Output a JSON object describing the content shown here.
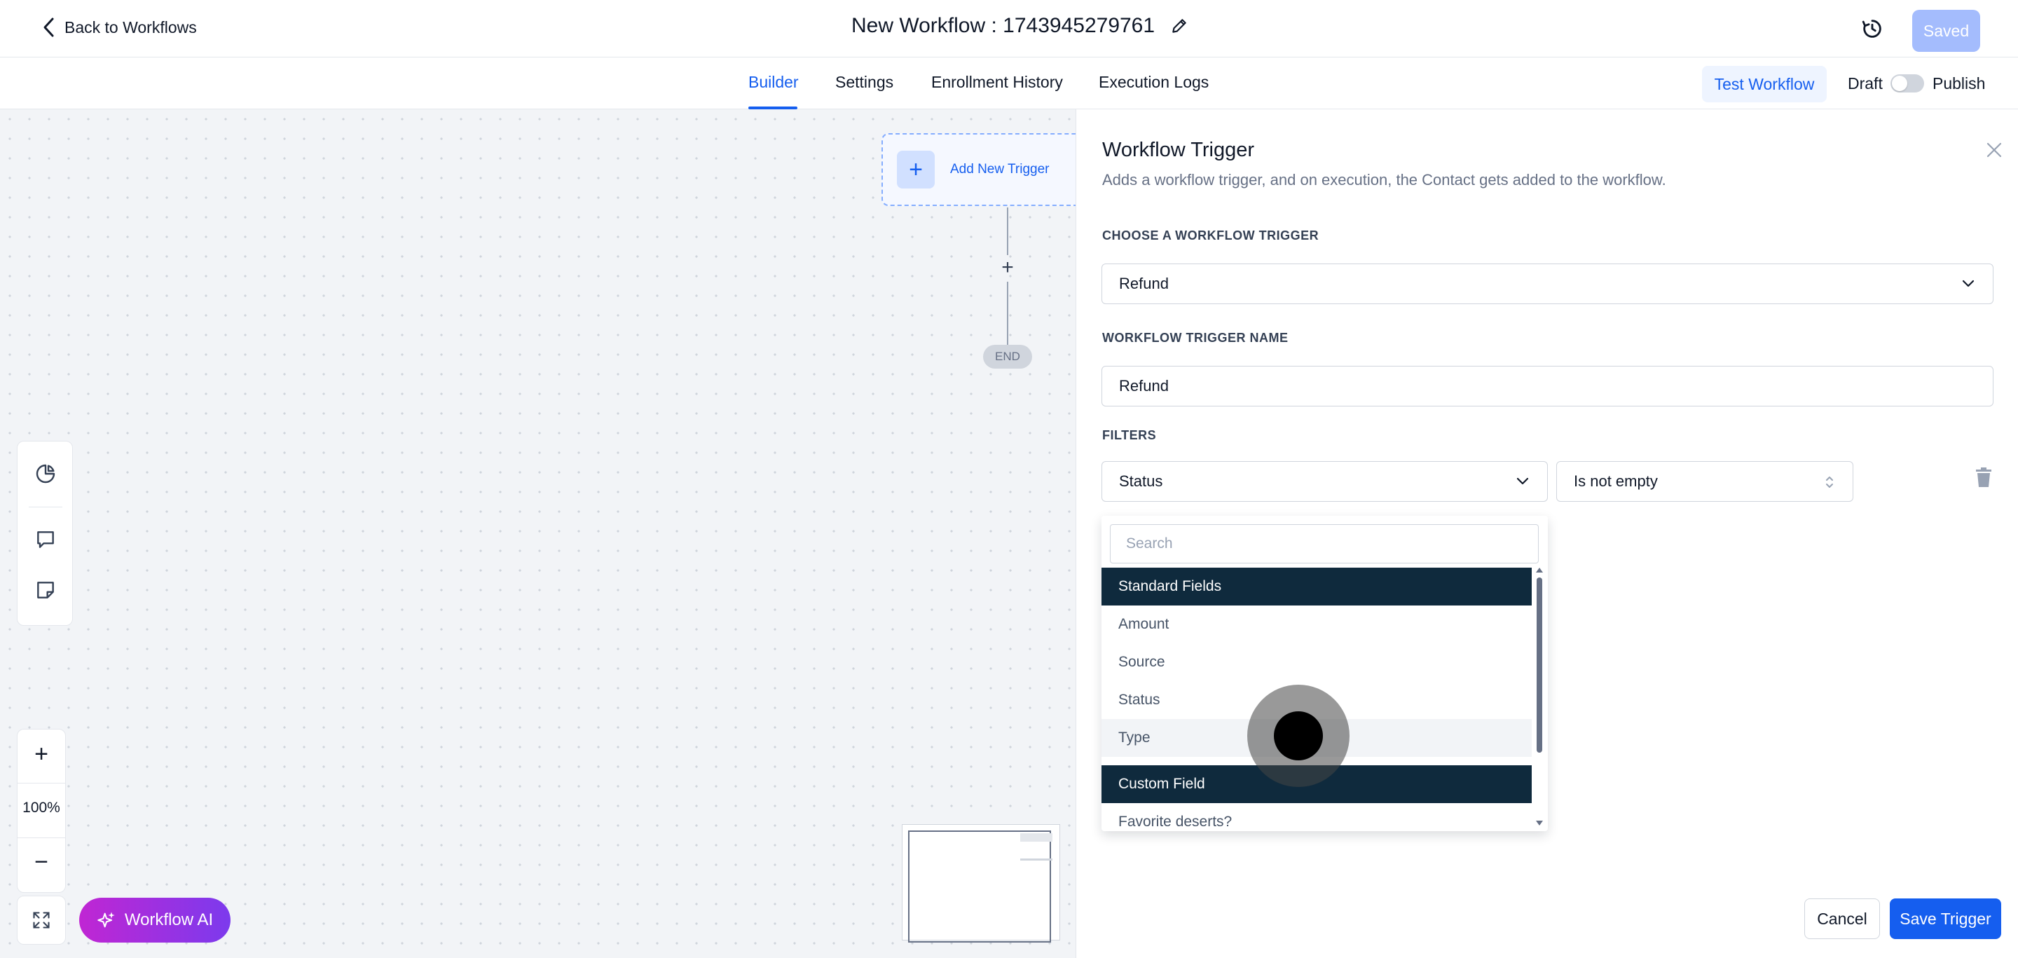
{
  "header": {
    "back_label": "Back to Workflows",
    "title": "New Workflow : 1743945279761",
    "saved_label": "Saved"
  },
  "tabs": [
    {
      "label": "Builder",
      "active": true
    },
    {
      "label": "Settings",
      "active": false
    },
    {
      "label": "Enrollment History",
      "active": false
    },
    {
      "label": "Execution Logs",
      "active": false
    }
  ],
  "toolbar": {
    "test_label": "Test Workflow",
    "draft_label": "Draft",
    "publish_label": "Publish",
    "published": false
  },
  "canvas": {
    "add_trigger_label": "Add New Trigger",
    "add_step_symbol": "+",
    "end_label": "END",
    "zoom_in": "+",
    "zoom_level": "100%",
    "zoom_out": "−",
    "ai_label": "Workflow AI"
  },
  "panel": {
    "title": "Workflow Trigger",
    "description": "Adds a workflow trigger, and on execution, the Contact gets added to the workflow.",
    "choose_label": "CHOOSE A WORKFLOW TRIGGER",
    "trigger_value": "Refund",
    "name_label": "WORKFLOW TRIGGER NAME",
    "name_value": "Refund",
    "filters_label": "FILTERS",
    "filter_field": "Status",
    "filter_operator": "Is not empty",
    "cancel_label": "Cancel",
    "save_label": "Save Trigger"
  },
  "dropdown": {
    "search_placeholder": "Search",
    "groups": [
      {
        "label": "Standard Fields",
        "items": [
          "Amount",
          "Source",
          "Status",
          "Type"
        ]
      },
      {
        "label": "Custom Field",
        "items": [
          "Favorite deserts?"
        ]
      }
    ],
    "hovered_item": "Type"
  },
  "colors": {
    "primary": "#155eef",
    "group_header": "#0f2a3d",
    "saved_disabled": "#a4bcfd",
    "ai_gradient_start": "#c026d3",
    "ai_gradient_end": "#7c3aed"
  }
}
